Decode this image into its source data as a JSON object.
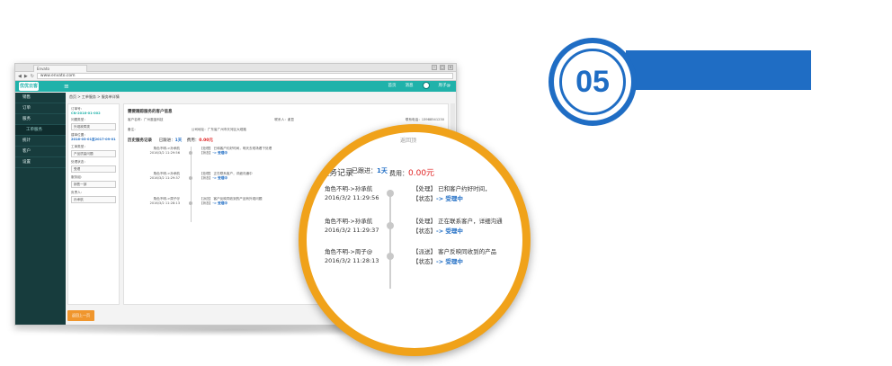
{
  "badge": {
    "number": "05"
  },
  "browser": {
    "tab_title": "Envato",
    "url": "www.envato.com",
    "win_min": "–",
    "win_max": "□",
    "win_close": "×"
  },
  "app": {
    "logo": "优优云客",
    "menu_icon": "≡",
    "header_items": [
      "首页",
      "消息",
      "周子@"
    ]
  },
  "sidebar": {
    "items": [
      "销售",
      "订单",
      "服务",
      "工单服务",
      "统计",
      "客户",
      "设置"
    ]
  },
  "breadcrumb": "首页  >  工单服务  >  服务单详情",
  "left_form": {
    "ticket_label": "订单号：",
    "ticket_no": "CN-2016-01-002",
    "product_label": "问题类型：",
    "product_value": "外观故障类",
    "time_label": "建单位置：",
    "time_value": "2016-03-01至2017-09-01",
    "type_label": "工单类型：",
    "type_value": "产品质量问题",
    "brand_label": "处理状态：",
    "brand_value": "受理",
    "dept_label": "服务组：",
    "dept_value": "销售一部",
    "person_label": "负责人：",
    "person_value": "孙承航",
    "confirm_button": "返回上一页"
  },
  "right_panel": {
    "section1_title": "需要跟踪服务的客户信息",
    "customer": "客户名称：广州墨蓝科技",
    "contact": "联系人：谢显",
    "phone": "联系电话：13988541230",
    "remark": "备注：",
    "address": "公司地址：广东省广州市天河区大观路",
    "section2_title": "历史服务记录",
    "done_label": "已跟进：",
    "done_value": "1天",
    "fee_label": "费用：",
    "fee_value": "0.00元",
    "records": [
      {
        "who": "角色不明->孙承航",
        "time": "2016/3/2 11:29:56",
        "action": "【处理】 已和客户约好时间，明天去现场看下处理",
        "status_label": "【状态】",
        "status": "-> 受理中"
      },
      {
        "who": "角色不明->孙承航",
        "time": "2016/3/2 11:29:37",
        "action": "【处理】 正在联系客户，详细沟通中",
        "status_label": "【状态】",
        "status": "-> 受理中"
      },
      {
        "who": "角色不明->周子@",
        "time": "2016/3/2 11:28:13",
        "action": "【派送】 客户反映同收到的产品有外观问题",
        "status_label": "【状态】",
        "status": "-> 受理中"
      }
    ]
  },
  "magnifier": {
    "title": "服务记录",
    "done_label": "已跟进：",
    "done_value": "1天",
    "fee_label": "费用：",
    "fee_value": "0.00元",
    "topright": "返回顶",
    "records": [
      {
        "who": "角色不明->孙承航",
        "time": "2016/3/2 11:29:56",
        "action": "【处理】 已和客户约好时间，",
        "status_label": "【状态】",
        "status": "-> 受理中"
      },
      {
        "who": "角色不明->孙承航",
        "time": "2016/3/2 11:29:37",
        "action": "【处理】 正在联系客户，详细沟通",
        "status_label": "【状态】",
        "status": "-> 受理中"
      },
      {
        "who": "角色不明->周子@",
        "time": "2016/3/2 11:28:13",
        "action": "【派送】 客户反映同收到的产品",
        "status_label": "【状态】",
        "status": "-> 受理中"
      }
    ]
  }
}
